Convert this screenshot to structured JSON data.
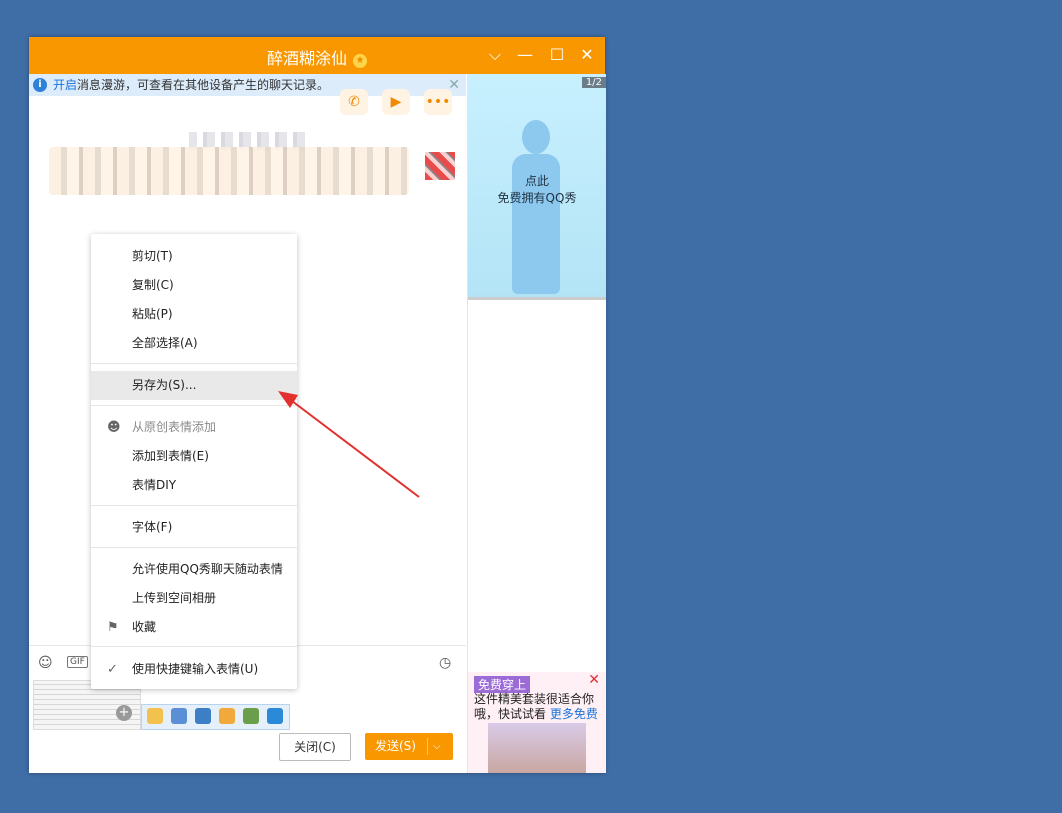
{
  "window": {
    "title": "醉酒糊涂仙",
    "controls": {
      "dropdown": "⌵",
      "minimize": "—",
      "maximize": "☐",
      "close": "✕"
    }
  },
  "notice": {
    "link": "开启",
    "text": "消息漫游，可查看在其他设备产生的聊天记录。",
    "close": "✕"
  },
  "chat_actions": {
    "call": "✆",
    "video": "▶",
    "more": "•••"
  },
  "toolbar": {
    "gif": "GIF"
  },
  "thumbnail": {
    "plus": "+"
  },
  "buttons": {
    "close_label": "关闭(C)",
    "send_label": "发送(S)",
    "send_arrow": "⌵"
  },
  "qq_show": {
    "page": "1/2",
    "line1": "点此",
    "line2": "免费拥有QQ秀"
  },
  "ad": {
    "tag": "免费穿上",
    "close": "✕",
    "text": "这件精美套装很适合你哦，快试试看",
    "link": "更多免费"
  },
  "context_menu": {
    "items": [
      {
        "label": "剪切(T)"
      },
      {
        "label": "复制(C)"
      },
      {
        "label": "粘贴(P)"
      },
      {
        "label": "全部选择(A)"
      },
      {
        "label": "另存为(S)..."
      },
      {
        "label": "从原创表情添加"
      },
      {
        "label": "添加到表情(E)"
      },
      {
        "label": "表情DIY"
      },
      {
        "label": "字体(F)"
      },
      {
        "label": "允许使用QQ秀聊天随动表情"
      },
      {
        "label": "上传到空间相册"
      },
      {
        "label": "收藏"
      },
      {
        "label": "使用快捷键输入表情(U)"
      }
    ]
  },
  "colors": {
    "accent": "#f99700",
    "desktop": "#3f6da6",
    "annotation_arrow": "#e3302f"
  }
}
